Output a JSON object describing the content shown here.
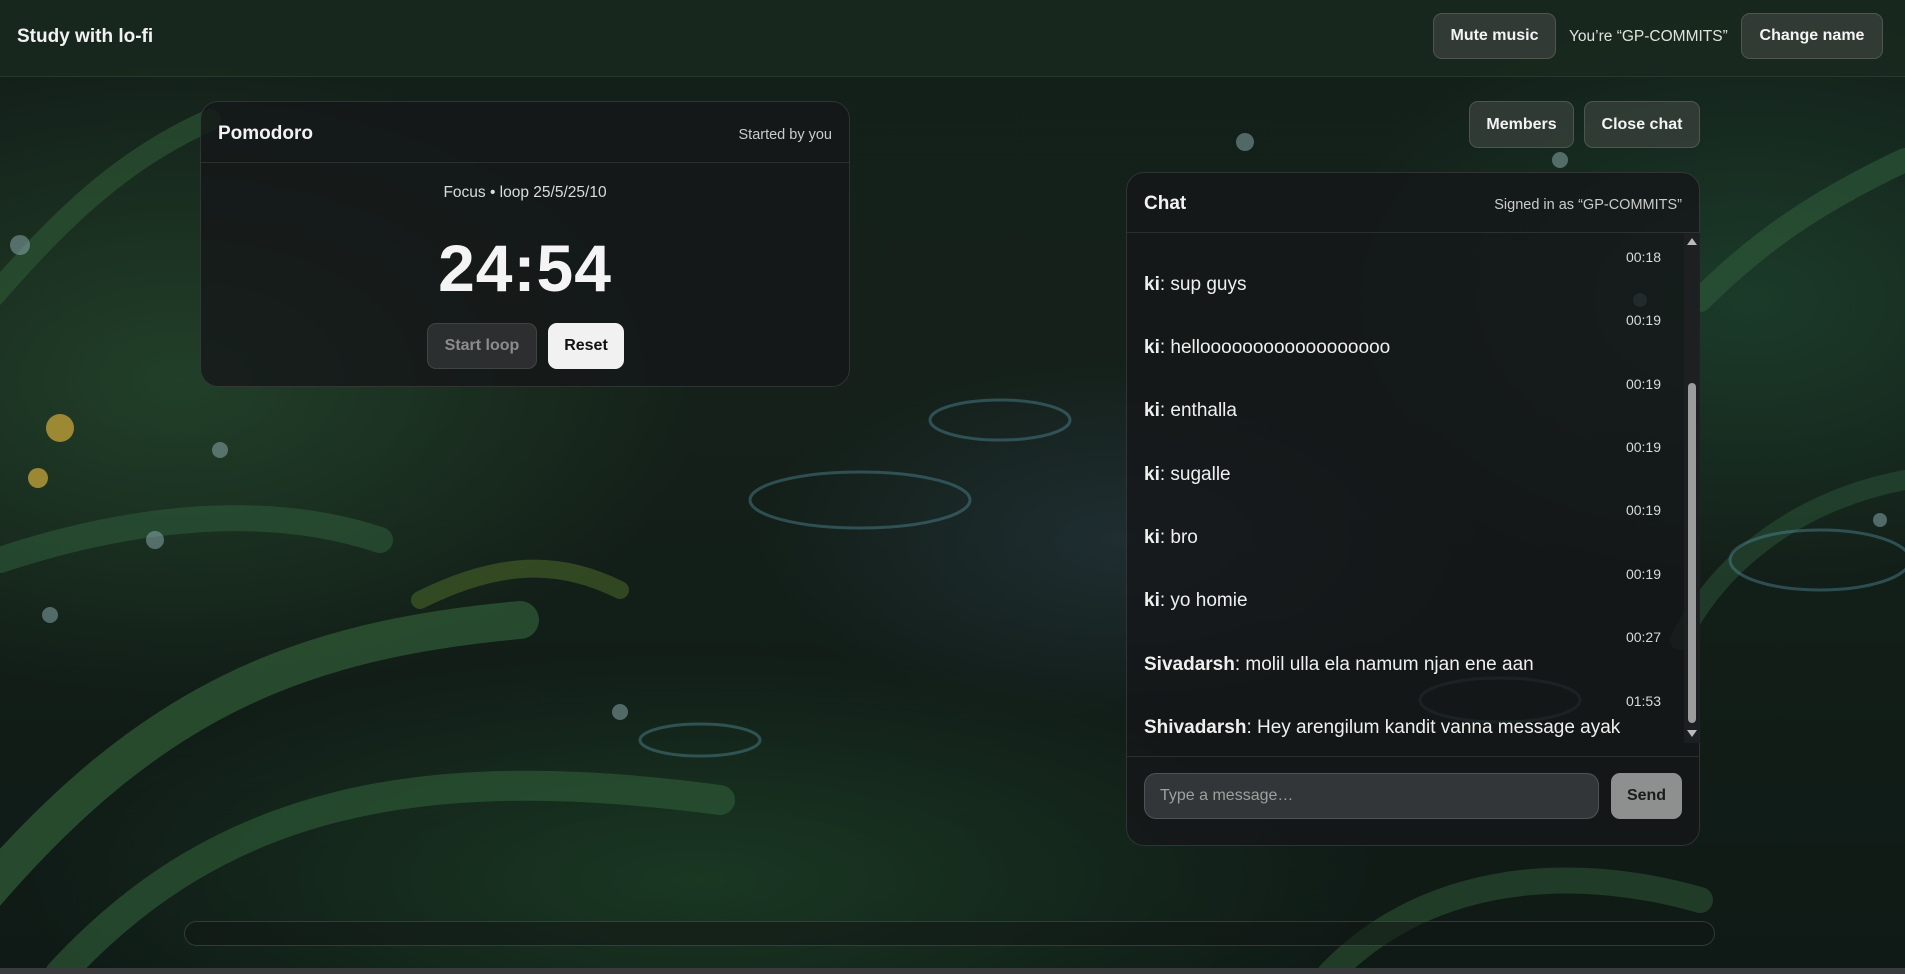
{
  "app": {
    "title": "Study with lo-fi"
  },
  "header": {
    "mute_label": "Mute music",
    "you_label": "You’re “GP-COMMITS”",
    "change_name_label": "Change name"
  },
  "pomodoro": {
    "title": "Pomodoro",
    "started_by": "Started by you",
    "mode": "Focus • loop 25/5/25/10",
    "time": "24:54",
    "start_label": "Start loop",
    "reset_label": "Reset"
  },
  "chat_controls": {
    "members_label": "Members",
    "close_label": "Close chat"
  },
  "chat": {
    "title": "Chat",
    "signed_in": "Signed in as “GP-COMMITS”",
    "messages": [
      {
        "time": "00:18",
        "user": "ki",
        "text": ": sup guys"
      },
      {
        "time": "00:19",
        "user": "ki",
        "text": ": helloooooooooooooooooo"
      },
      {
        "time": "00:19",
        "user": "ki",
        "text": ": enthalla"
      },
      {
        "time": "00:19",
        "user": "ki",
        "text": ": sugalle"
      },
      {
        "time": "00:19",
        "user": "ki",
        "text": ": bro"
      },
      {
        "time": "00:19",
        "user": "ki",
        "text": ": yo homie"
      },
      {
        "time": "00:27",
        "user": "Sivadarsh",
        "text": ": molil ulla ela namum njan ene aan"
      },
      {
        "time": "01:53",
        "user": "Shivadarsh",
        "text": ": Hey arengilum kandit vanna message ayak"
      }
    ],
    "input_placeholder": "Type a message…",
    "send_label": "Send"
  },
  "colors": {
    "send_button": "#8e908f",
    "reset_button": "#f1f1f1"
  }
}
